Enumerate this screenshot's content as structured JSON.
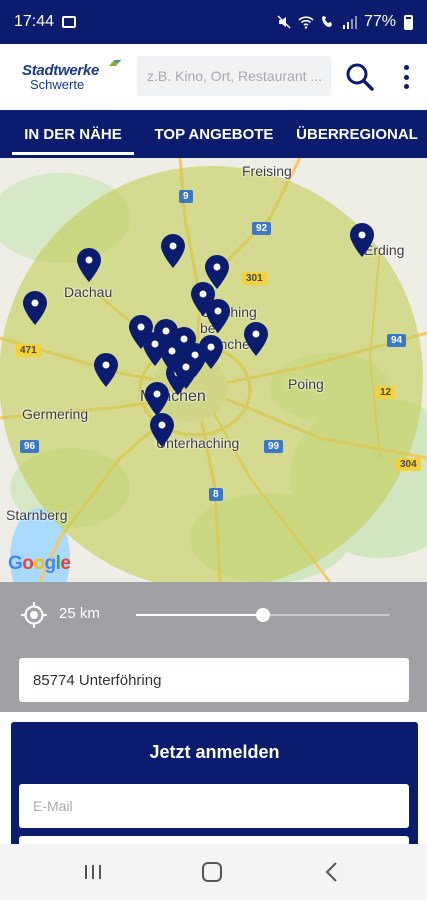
{
  "status_bar": {
    "time": "17:44",
    "battery": "77%",
    "icons": [
      "gallery-icon",
      "mute-icon",
      "wifi-icon",
      "wifi-call-icon",
      "signal-icon",
      "battery-icon"
    ]
  },
  "header": {
    "logo_line1": "Stadtwerke",
    "logo_line2": "Schwerte",
    "search_placeholder": "z.B. Kino, Ort, Restaurant ...",
    "search_icon": "search-icon",
    "menu_icon": "more-vert-icon"
  },
  "tabs": [
    {
      "label": "IN DER NÄHE",
      "active": true
    },
    {
      "label": "TOP ANGEBOTE",
      "active": false
    },
    {
      "label": "ÜBERREGIONAL",
      "active": false
    }
  ],
  "map": {
    "labels": [
      "Freising",
      "Erding",
      "Dachau",
      "Garching bei München",
      "München",
      "Poing",
      "Germering",
      "Unterhaching",
      "Starnberg"
    ],
    "road_numbers": [
      "9",
      "92",
      "301",
      "94",
      "471",
      "12",
      "96",
      "99",
      "8",
      "304"
    ],
    "attribution": "Google",
    "pin_count": 20,
    "colors": {
      "radius_fill": "#cbd36f",
      "pin": "#0b1c6e"
    }
  },
  "radius": {
    "icon": "my-location-icon",
    "label": "25 km",
    "value_fraction": 0.5
  },
  "location": {
    "value": "85774 Unterföhring"
  },
  "login": {
    "title": "Jetzt anmelden",
    "email_placeholder": "E-Mail"
  },
  "nav": {
    "icons": [
      "recent-apps-icon",
      "home-icon",
      "back-icon"
    ]
  },
  "colors": {
    "primary": "#0b1c6e",
    "panel_gray": "#9fa1a5"
  }
}
